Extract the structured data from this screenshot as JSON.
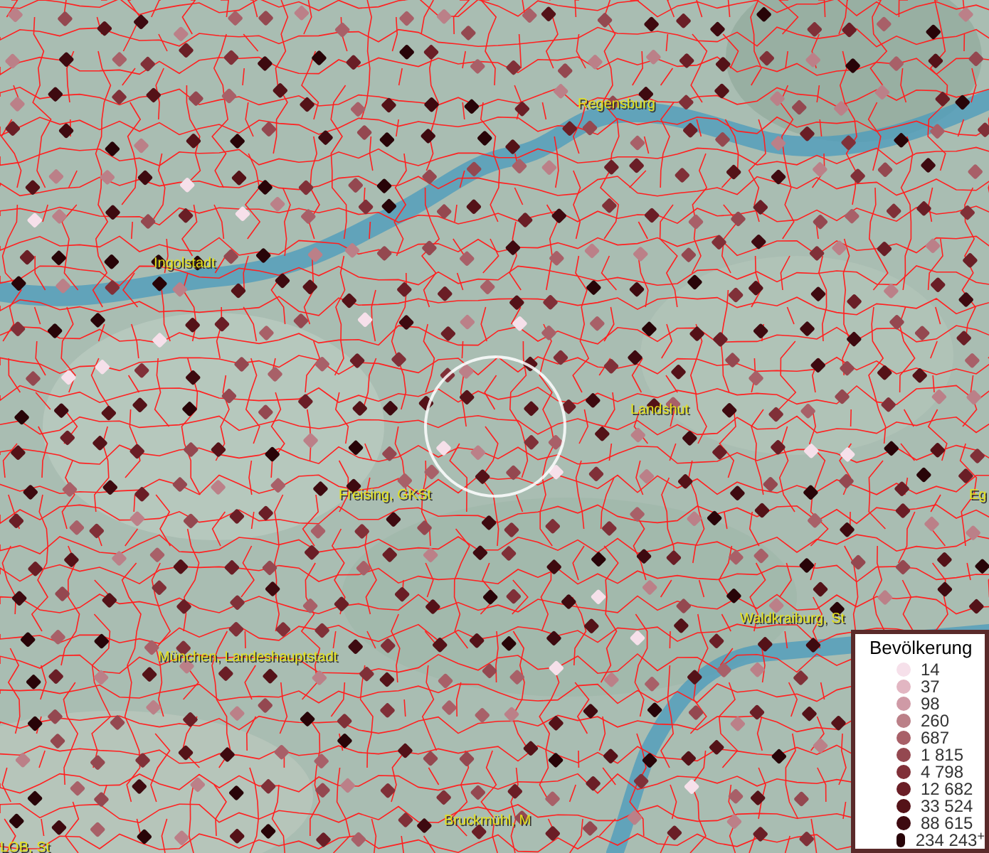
{
  "map": {
    "place_labels": [
      {
        "text": "Regensburg"
      },
      {
        "text": "Ingolstadt"
      },
      {
        "text": "Landshut"
      },
      {
        "text": "Freising, GKSt"
      },
      {
        "text": "Eg"
      },
      {
        "text": "Waldkraiburg, St"
      },
      {
        "text": "München, Landeshauptstadt"
      },
      {
        "text": "Bruckmühl, M"
      },
      {
        "text": "LOB, St"
      }
    ]
  },
  "legend": {
    "title": "Bevölkerung",
    "items": [
      {
        "label": "14",
        "color": "#f6e0ea"
      },
      {
        "label": "37",
        "color": "#e2b6c2"
      },
      {
        "label": "98",
        "color": "#cf9aa6"
      },
      {
        "label": "260",
        "color": "#bb8088"
      },
      {
        "label": "687",
        "color": "#a86068"
      },
      {
        "label": "1 815",
        "color": "#944850"
      },
      {
        "label": "4 798",
        "color": "#803038"
      },
      {
        "label": "12 682",
        "color": "#6a1e26"
      },
      {
        "label": "33 524",
        "color": "#541218"
      },
      {
        "label": "88 615",
        "color": "#3e0a10"
      },
      {
        "label": "234 243$^{+}$",
        "color": "#280408"
      }
    ]
  }
}
